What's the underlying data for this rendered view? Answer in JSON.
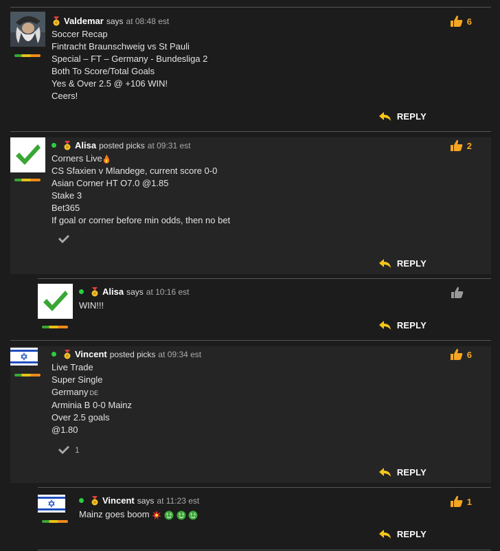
{
  "comments": [
    {
      "author": "Valdemar",
      "verb": "says",
      "time": "at 08:48 est",
      "lines": [
        "Soccer Recap",
        "Fintracht Braunschweig vs St Pauli",
        "Special – FT – Germany - Bundesliga 2",
        "Both To Score/Total Goals",
        "Yes & Over 2.5 @ +106 WIN!",
        "Ceers!"
      ],
      "likes": "6",
      "reply": "REPLY"
    },
    {
      "author": "Alisa",
      "verb": "posted picks",
      "time": "at 09:31 est",
      "lines": [
        "Corners Live",
        "CS Sfaxien v Mlandege, current score 0-0",
        "Asian Corner HT O7.0 @1.85",
        "Stake 3",
        "Bet365",
        "If goal or corner before min odds, then no bet"
      ],
      "likes": "2",
      "reply": "REPLY"
    },
    {
      "author": "Alisa",
      "verb": "says",
      "time": "at 10:16 est",
      "lines": [
        "WIN!!!"
      ],
      "likes": "",
      "reply": "REPLY"
    },
    {
      "author": "Vincent",
      "verb": "posted picks",
      "time": "at 09:34 est",
      "lines": [
        "Live Trade",
        "Super Single",
        "Germany",
        "Arminia B 0-0 Mainz",
        "Over 2.5 goals",
        "@1.80"
      ],
      "country_code": "DE",
      "check_count": "1",
      "likes": "6",
      "reply": "REPLY"
    },
    {
      "author": "Vincent",
      "verb": "says",
      "time": "at 11:23 est",
      "lines": [
        "Mainz goes boom"
      ],
      "likes": "1",
      "reply": "REPLY"
    }
  ],
  "colors": {
    "accent": "#f5a623",
    "online": "#2ecc40",
    "reply_arrow": "#f5c518"
  }
}
